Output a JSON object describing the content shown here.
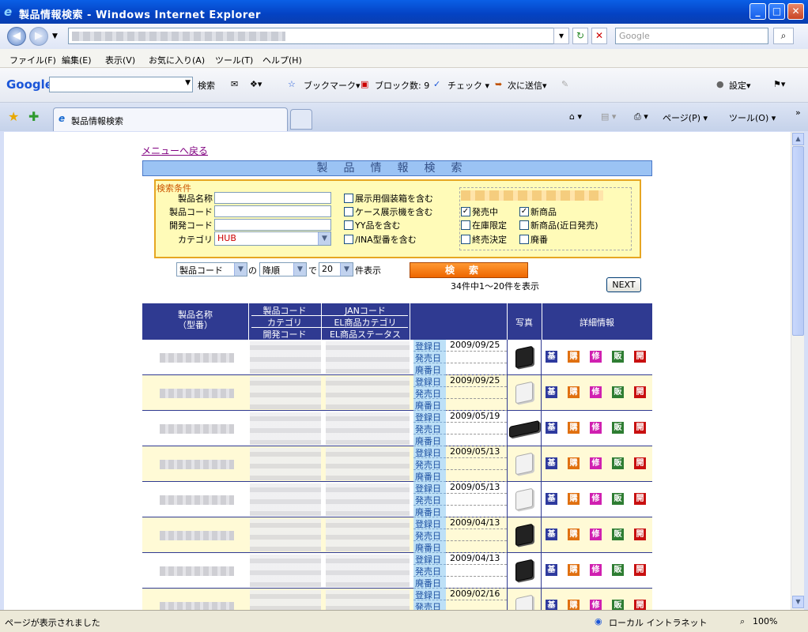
{
  "window": {
    "title": "製品情報検索 - Windows Internet Explorer",
    "minimize": "_",
    "maximize": "□",
    "close": "✕"
  },
  "address_bar": {
    "search_placeholder": "Google"
  },
  "menu": [
    "ファイル(F)",
    "編集(E)",
    "表示(V)",
    "お気に入り(A)",
    "ツール(T)",
    "ヘルプ(H)"
  ],
  "google_toolbar": {
    "logo": "Google",
    "search_btn": "検索",
    "bookmarks": "ブックマーク▾",
    "blocked": "ブロック数: 9",
    "check": "チェック ▾",
    "send": "次に送信▾",
    "settings": "設定▾"
  },
  "tab": {
    "label": "製品情報検索"
  },
  "tab_tools": {
    "page": "ページ(P) ▾",
    "tools": "ツール(O) ▾"
  },
  "page": {
    "menu_link": "メニューへ戻る",
    "title": "製品情報検索",
    "conditions": {
      "legend": "検索条件",
      "labels": [
        "製品名称",
        "製品コード",
        "開発コード",
        "カテゴリ"
      ],
      "category": "HUB",
      "checks_left": [
        "展示用個装箱を含む",
        "ケース展示機を含む",
        "YY品を含む",
        "/INA型番を含む"
      ],
      "checks_right": [
        {
          "label": "発売中",
          "checked": true
        },
        {
          "label": "新商品",
          "checked": true
        },
        {
          "label": "在庫限定",
          "checked": false
        },
        {
          "label": "新商品(近日発売)",
          "checked": false
        },
        {
          "label": "終売決定",
          "checked": false
        },
        {
          "label": "廃番",
          "checked": false
        }
      ]
    },
    "sort": {
      "field": "製品コード",
      "of": "の",
      "order": "降順",
      "de": "で",
      "count": "20",
      "suffix": "件表示"
    },
    "search_button": "検索",
    "result_count": "34件中1～20件を表示",
    "next_button": "NEXT",
    "table": {
      "col1": "製品名称\n（型番）",
      "col2": [
        "製品コード",
        "カテゴリ",
        "開発コード"
      ],
      "col3": [
        "JANコード",
        "EL商品カテゴリ",
        "EL商品ステータス"
      ],
      "col_photo": "写真",
      "col_detail": "詳細情報",
      "date_labels": [
        "登録日",
        "発売日",
        "廃番日"
      ],
      "actions": [
        {
          "label": "基",
          "color": "#2e3a9e"
        },
        {
          "label": "購",
          "color": "#e07010"
        },
        {
          "label": "修",
          "color": "#d020b0"
        },
        {
          "label": "販",
          "color": "#2e7d32"
        },
        {
          "label": "開",
          "color": "#c81010"
        }
      ],
      "rows": [
        {
          "reg": "2009/09/25",
          "photo": "black-hub-icon"
        },
        {
          "reg": "2009/09/25",
          "photo": "white-hub-icon"
        },
        {
          "reg": "2009/05/19",
          "photo": "black-switch-icon"
        },
        {
          "reg": "2009/05/13",
          "photo": "white-hub-icon"
        },
        {
          "reg": "2009/05/13",
          "photo": "white-hub-icon"
        },
        {
          "reg": "2009/04/13",
          "photo": "black-hub-icon"
        },
        {
          "reg": "2009/04/13",
          "photo": "black-hub-icon"
        },
        {
          "reg": "2009/02/16",
          "photo": "white-hub-icon"
        }
      ]
    }
  },
  "status": {
    "text": "ページが表示されました",
    "zone": "ローカル イントラネット",
    "zoom": "100%"
  }
}
